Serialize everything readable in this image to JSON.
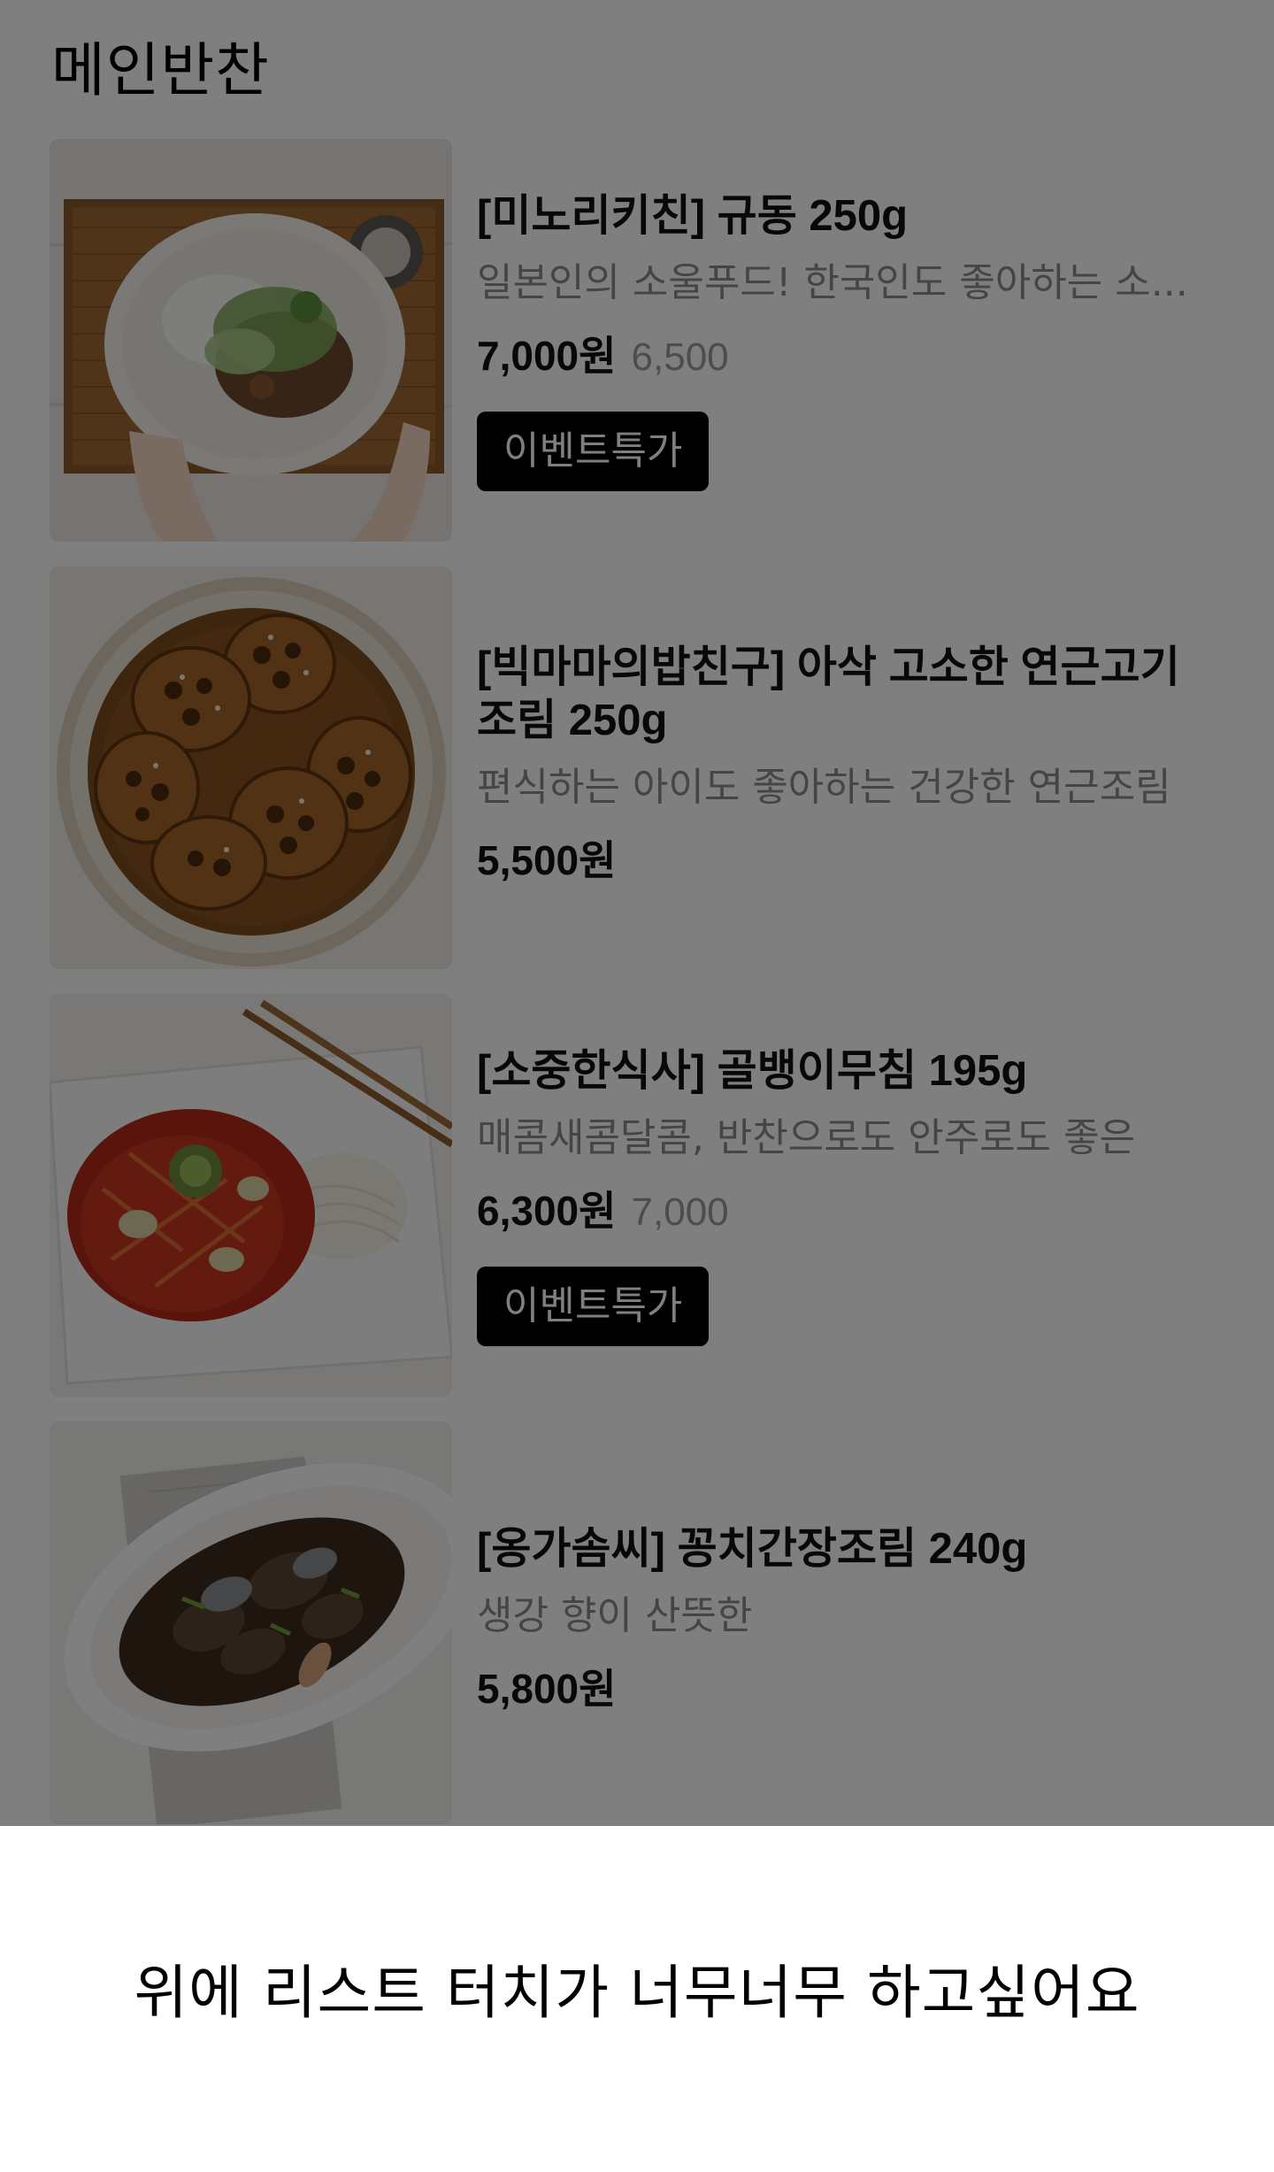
{
  "section": {
    "title": "메인반찬"
  },
  "products": [
    {
      "name": "[미노리키친] 규동 250g",
      "description": "일본인의 소울푸드! 한국인도 좋아하는 소...",
      "price": "7,000원",
      "original_price": "6,500",
      "badge": "이벤트특가"
    },
    {
      "name": "[빅마마의밥친구] 아삭 고소한 연근고기조림 250g",
      "description": "편식하는 아이도 좋아하는 건강한 연근조림",
      "price": "5,500원"
    },
    {
      "name": "[소중한식사] 골뱅이무침 195g",
      "description": "매콤새콤달콤, 반찬으로도 안주로도 좋은",
      "price": "6,300원",
      "original_price": "7,000",
      "badge": "이벤트특가"
    },
    {
      "name": "[옹가솜씨] 꽁치간장조림 240g",
      "description": "생강 향이 산뜻한",
      "price": "5,800원"
    }
  ],
  "bottom_sheet": {
    "message": "위에 리스트 터치가 너무너무 하고싶어요"
  },
  "colors": {
    "overlay": "rgba(0,0,0,0.5)",
    "badge_bg": "#000000",
    "badge_text": "#ffffff",
    "title_text": "#111111",
    "description_text": "#8a8a8a"
  }
}
